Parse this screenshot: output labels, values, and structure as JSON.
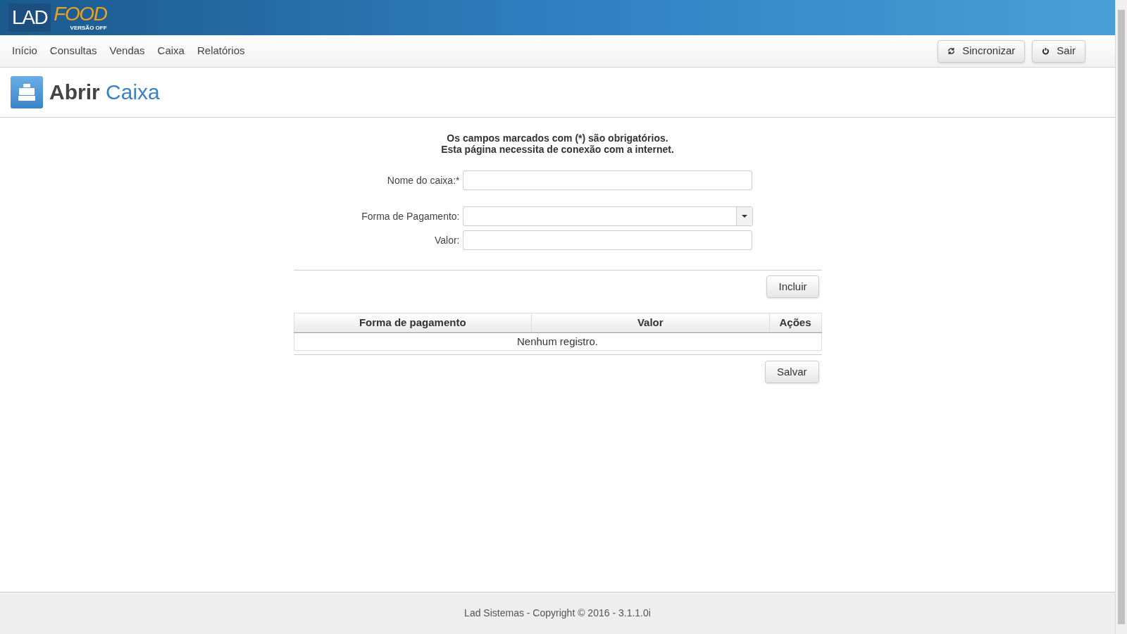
{
  "logo": {
    "part_1": "LAD",
    "part_2": "FOOD",
    "subtitle": "VERSÃO OFF"
  },
  "nav": {
    "items": [
      {
        "label": "Início"
      },
      {
        "label": "Consultas"
      },
      {
        "label": "Vendas"
      },
      {
        "label": "Caixa"
      },
      {
        "label": "Relatórios"
      }
    ],
    "buttons": [
      {
        "label": "Sincronizar",
        "kind": "sync"
      },
      {
        "label": "Sair",
        "kind": "power"
      }
    ]
  },
  "page_title": {
    "part_1": "Abrir",
    "part_2": "Caixa"
  },
  "notice": [
    "Os campos marcados com (*) são obrigatórios.",
    "Esta página necessita de conexão com a internet."
  ],
  "form": {
    "name_label": "Nome do caixa:*",
    "payment_label": "Forma de Pagamento:",
    "value_label": "Valor:",
    "add_button": "Incluir"
  },
  "table": {
    "columns": [
      "Forma de pagamento",
      "Valor",
      "Ações"
    ],
    "empty_message": "Nenhum registro."
  },
  "save_button": "Salvar",
  "footer": "Lad Sistemas - Copyright © 2016 - 3.1.1.0i"
}
